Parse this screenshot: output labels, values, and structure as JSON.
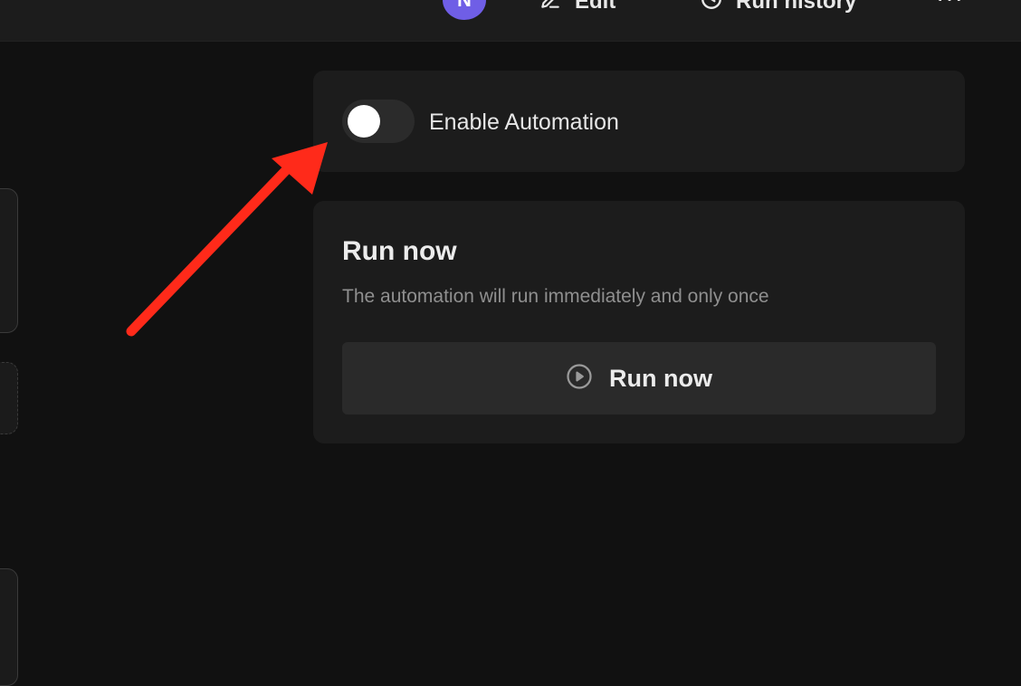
{
  "header": {
    "avatar_initial": "N",
    "edit_label": "Edit",
    "edit_icon": "pencil-icon",
    "run_history_label": "Run history",
    "run_history_icon": "clock-icon",
    "more_label": "···"
  },
  "enable_card": {
    "toggle_label": "Enable Automation",
    "toggle_on": false
  },
  "run_card": {
    "title": "Run now",
    "description": "The automation will run immediately and only once",
    "button_label": "Run now",
    "button_icon": "play-circle-icon"
  },
  "colors": {
    "background": "#111111",
    "card": "#1c1c1c",
    "avatar": "#6f5ee6",
    "annotation_arrow": "#ff2a1a"
  }
}
